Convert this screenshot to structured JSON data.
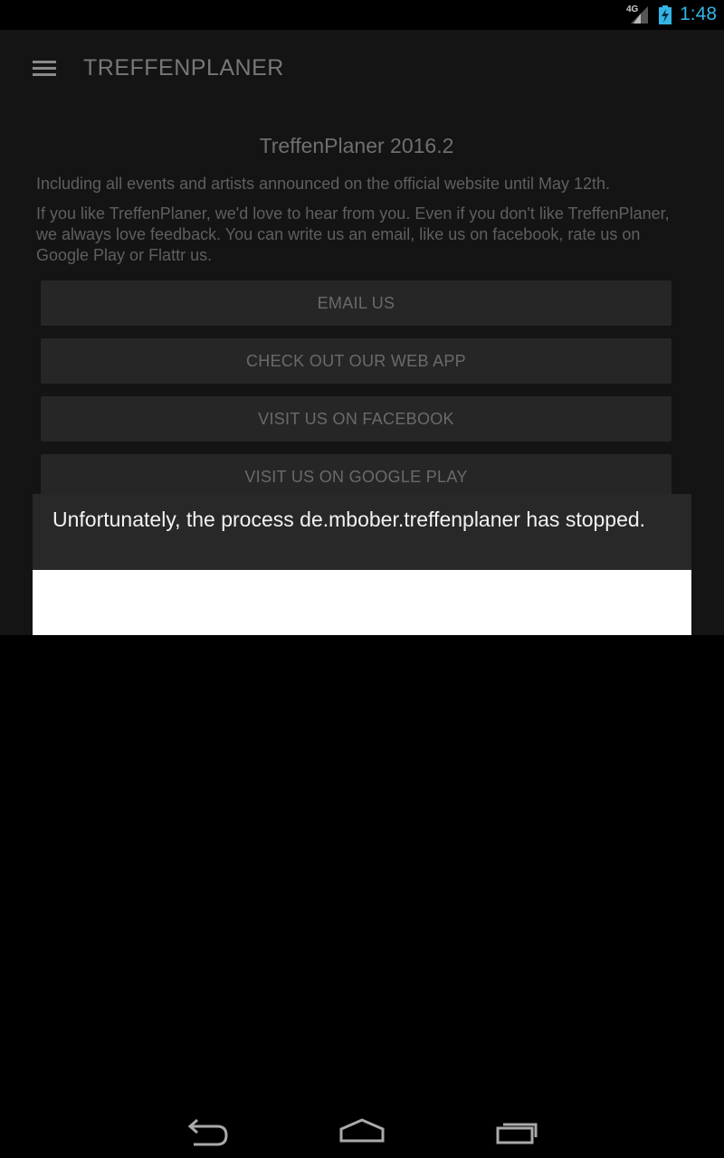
{
  "status_bar": {
    "network_label": "4G",
    "time": "1:48",
    "icons": [
      "network-signal-icon",
      "battery-charging-icon"
    ]
  },
  "action_bar": {
    "menu_icon": "menu-icon",
    "title": "TREFFENPLANER"
  },
  "about": {
    "version_title": "TreffenPlaner 2016.2",
    "paragraph1": "Including all events and artists announced on the official website until May 12th.",
    "paragraph2": "If you like TreffenPlaner, we'd love to hear from you. Even if you don't like TreffenPlaner, we always love feedback. You can write us an email, like us on facebook, rate us on Google Play or Flattr us.",
    "buttons": [
      {
        "label": "EMAIL US"
      },
      {
        "label": "CHECK OUT OUR WEB APP"
      },
      {
        "label": "VISIT US ON FACEBOOK"
      },
      {
        "label": "VISIT US ON GOOGLE PLAY"
      }
    ]
  },
  "dialog": {
    "message": "Unfortunately, the process de.mbober.treffenplaner has stopped."
  },
  "nav_bar": {
    "icons": [
      "back-icon",
      "home-icon",
      "recent-apps-icon"
    ]
  },
  "colors": {
    "clock": "#33b5e5",
    "action_bar_bg": "#131413",
    "dialog_bg": "#282828"
  }
}
